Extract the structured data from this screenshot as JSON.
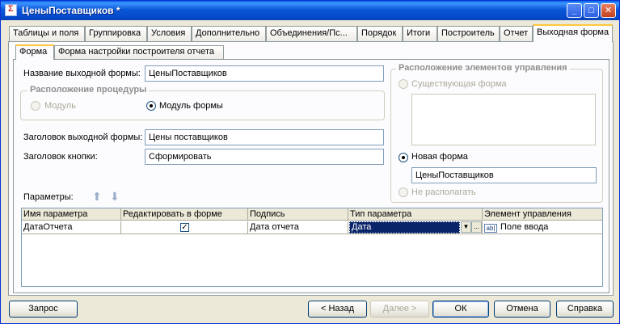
{
  "window": {
    "title": "ЦеныПоставщиков *"
  },
  "window_buttons": {
    "minimize": "_",
    "maximize": "□",
    "close": "✕"
  },
  "tabs": [
    {
      "label": "Таблицы и поля"
    },
    {
      "label": "Группировка"
    },
    {
      "label": "Условия"
    },
    {
      "label": "Дополнительно"
    },
    {
      "label": "Объединения/Пс..."
    },
    {
      "label": "Порядок"
    },
    {
      "label": "Итоги"
    },
    {
      "label": "Построитель"
    },
    {
      "label": "Отчет"
    },
    {
      "label": "Выходная форма"
    }
  ],
  "subtabs": [
    {
      "label": "Форма"
    },
    {
      "label": "Форма настройки построителя отчета"
    }
  ],
  "form": {
    "output_name_label": "Название выходной формы:",
    "output_name_value": "ЦеныПоставщиков",
    "procedure_group_title": "Расположение процедуры",
    "module_label": "Модуль",
    "form_module_label": "Модуль формы",
    "output_title_label": "Заголовок выходной формы:",
    "output_title_value": "Цены поставщиков",
    "button_title_label": "Заголовок кнопки:",
    "button_title_value": "Сформировать",
    "params_label": "Параметры:"
  },
  "controls_group": {
    "title": "Расположение элементов управления",
    "existing_form_label": "Существующая форма",
    "new_form_label": "Новая форма",
    "new_form_value": "ЦеныПоставщиков",
    "no_place_label": "Не располагать"
  },
  "params_table": {
    "headers": [
      "Имя параметра",
      "Редактировать в форме",
      "Подпись",
      "Тип параметра",
      "Элемент управления"
    ],
    "rows": [
      {
        "name": "ДатаОтчета",
        "editable": true,
        "caption": "Дата отчета",
        "type": "Дата",
        "control": "Поле ввода"
      }
    ]
  },
  "icons": {
    "ab_icon_text": "ab|",
    "check_mark": "✓",
    "dropdown_arrow": "▼",
    "ellipsis": "..."
  },
  "buttons": {
    "query": "Запрос",
    "back": "< Назад",
    "next": "Далее >",
    "ok": "ОК",
    "cancel": "Отмена",
    "help": "Справка"
  }
}
